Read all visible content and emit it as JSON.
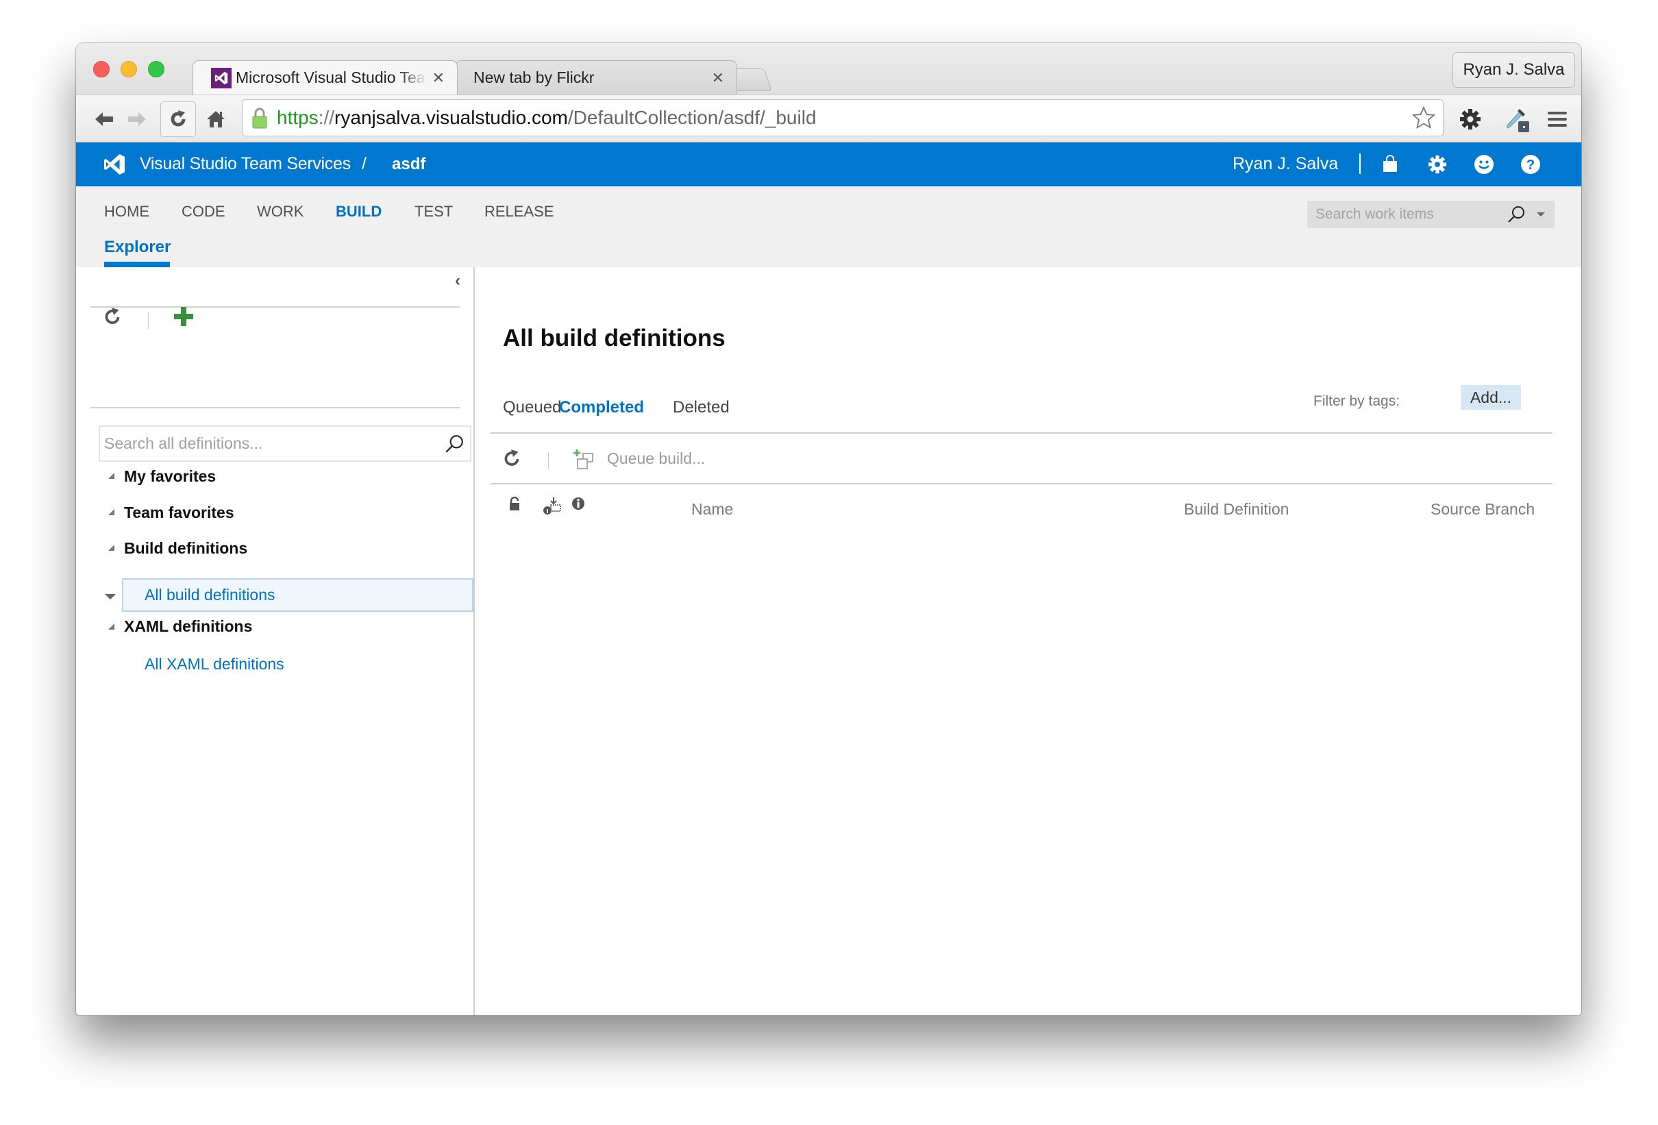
{
  "browser": {
    "tabs": [
      {
        "title": "Microsoft Visual Studio Team Services",
        "active": true,
        "favicon": "visual-studio-icon"
      },
      {
        "title": "New tab by Flickr",
        "active": false
      }
    ],
    "tab_close_glyph": "✕",
    "profile_name": "Ryan J. Salva",
    "url": {
      "scheme": "https",
      "separator": "://",
      "host": "ryanjsalva.visualstudio.com",
      "path": "/DefaultCollection/asdf/_build"
    },
    "toolbar_icons": [
      "back-arrow-icon",
      "forward-arrow-icon",
      "reload-icon",
      "home-icon",
      "lock-icon",
      "bookmark-star-icon",
      "settings-gear-icon",
      "eyedropper-extension-icon",
      "menu-hamburger-icon"
    ]
  },
  "header": {
    "brand": "Visual Studio Team Services",
    "separator": "/",
    "project": "asdf",
    "user": "Ryan J. Salva",
    "icons": [
      "marketplace-bag-icon",
      "settings-gear-icon",
      "feedback-smiley-icon",
      "help-icon"
    ],
    "color": "#0078d0"
  },
  "hub_nav": {
    "items": [
      {
        "label": "HOME",
        "active": false
      },
      {
        "label": "CODE",
        "active": false
      },
      {
        "label": "WORK",
        "active": false
      },
      {
        "label": "BUILD",
        "active": true
      },
      {
        "label": "TEST",
        "active": false
      },
      {
        "label": "RELEASE",
        "active": false
      }
    ],
    "sub_hub": "Explorer",
    "search_placeholder": "Search work items"
  },
  "left_pane": {
    "search_placeholder": "Search all definitions...",
    "tree": [
      {
        "label": "My favorites",
        "type": "group"
      },
      {
        "label": "Team favorites",
        "type": "group"
      },
      {
        "label": "Build definitions",
        "type": "group"
      },
      {
        "label": "All build definitions",
        "type": "leaf",
        "selected": true
      },
      {
        "label": "XAML definitions",
        "type": "group"
      },
      {
        "label": "All XAML definitions",
        "type": "leaf",
        "selected": false
      }
    ]
  },
  "main": {
    "title": "All build definitions",
    "tabs": [
      {
        "label": "Queued",
        "active": false
      },
      {
        "label": "Completed",
        "active": true
      },
      {
        "label": "Deleted",
        "active": false
      }
    ],
    "filter_label": "Filter by tags:",
    "add_tag_label": "Add...",
    "queue_build_label": "Queue build...",
    "columns": [
      "Name",
      "Build Definition",
      "Source Branch"
    ],
    "rows": []
  },
  "colors": {
    "accent": "#0072c6",
    "add_button_green": "#3a8f3a"
  }
}
